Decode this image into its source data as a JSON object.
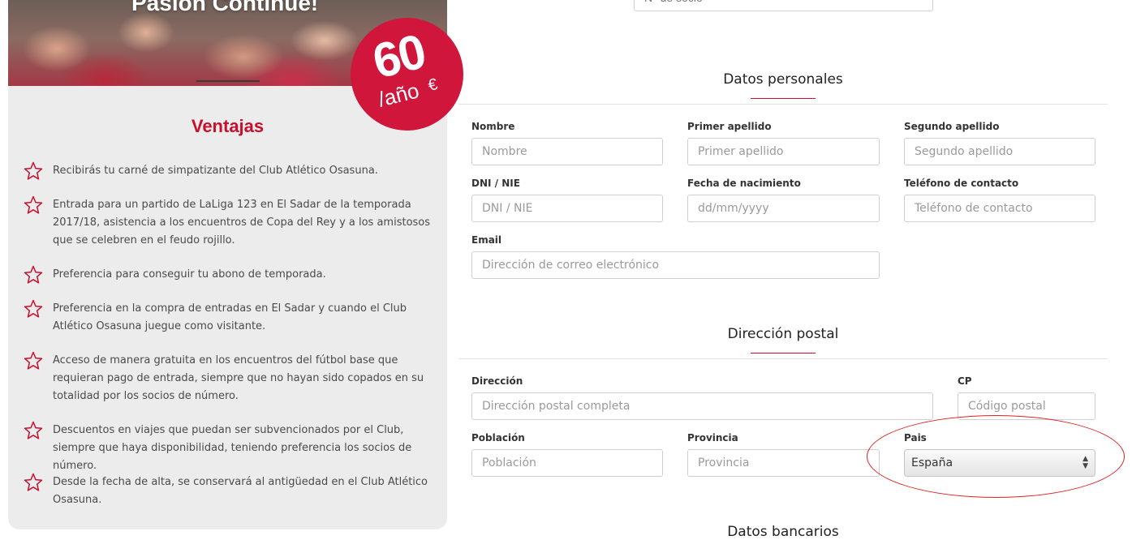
{
  "promo": {
    "hero_title": "Pasión Continúe!",
    "price": {
      "amount": "60",
      "currency": "€",
      "period": "/año"
    },
    "benefits_title": "Ventajas",
    "benefits": [
      "Recibirás tu carné de simpatizante del Club Atlético Osasuna.",
      "Entrada para un partido de LaLiga 123 en El Sadar de la temporada 2017/18, asistencia a los encuentros de Copa del Rey y a los amistosos que se celebren en el feudo rojillo.",
      "Preferencia para conseguir tu abono de temporada.",
      "Preferencia en la compra de entradas en El Sadar y cuando el Club Atlético Osasuna juegue como visitante.",
      "Acceso de manera gratuita en los encuentros del fútbol base que requieran pago de entrada, siempre que no hayan sido copados en su totalidad por los socios de número.",
      "Descuentos en viajes que puedan ser subvencionados por el Club, siempre que haya disponibilidad, teniendo preferencia los socios de número.",
      "Desde la fecha de alta, se conservará al antigüedad en el Club Atlético Osasuna."
    ],
    "colors": {
      "accent": "#c8102e",
      "badge": "#d0163a",
      "panel": "#ececec"
    },
    "icon": "star-outline-icon"
  },
  "form": {
    "top_input": {
      "placeholder": "N° de socio"
    },
    "personal": {
      "title": "Datos personales",
      "nombre": {
        "label": "Nombre",
        "placeholder": "Nombre"
      },
      "apellido1": {
        "label": "Primer apellido",
        "placeholder": "Primer apellido"
      },
      "apellido2": {
        "label": "Segundo apellido",
        "placeholder": "Segundo apellido"
      },
      "dni": {
        "label": "DNI / NIE",
        "placeholder": "DNI / NIE"
      },
      "nacimiento": {
        "label": "Fecha de nacimiento",
        "placeholder": "dd/mm/yyyy"
      },
      "telefono": {
        "label": "Teléfono de contacto",
        "placeholder": "Teléfono de contacto"
      },
      "email": {
        "label": "Email",
        "placeholder": "Dirección de correo electrónico"
      }
    },
    "postal": {
      "title": "Dirección postal",
      "direccion": {
        "label": "Dirección",
        "placeholder": "Dirección postal completa"
      },
      "cp": {
        "label": "CP",
        "placeholder": "Código postal"
      },
      "poblacion": {
        "label": "Población",
        "placeholder": "Población"
      },
      "provincia": {
        "label": "Provincia",
        "placeholder": "Provincia"
      },
      "pais": {
        "label": "Pais",
        "value": "España"
      }
    },
    "bank": {
      "title": "Datos bancarios"
    }
  }
}
